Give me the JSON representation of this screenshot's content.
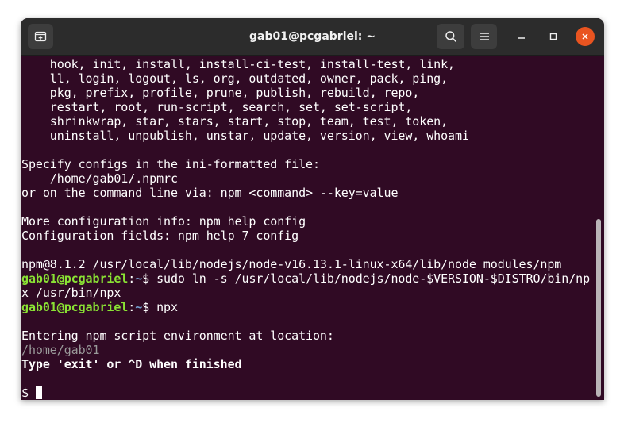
{
  "window": {
    "title": "gab01@pcgabriel: ~"
  },
  "titlebar_icons": {
    "new_tab": "new-tab-icon",
    "search": "search-icon",
    "menu": "hamburger-menu-icon",
    "minimize": "minimize-icon",
    "maximize": "maximize-icon",
    "close": "close-icon"
  },
  "colors": {
    "terminal_bg": "#300a24",
    "titlebar_bg": "#2c2c2c",
    "prompt_user": "#8ae234",
    "prompt_path": "#729fcf",
    "close_button": "#e95420"
  },
  "terminal": {
    "lines": [
      "    hook, init, install, install-ci-test, install-test, link,",
      "    ll, login, logout, ls, org, outdated, owner, pack, ping,",
      "    pkg, prefix, profile, prune, publish, rebuild, repo,",
      "    restart, root, run-script, search, set, set-script,",
      "    shrinkwrap, star, stars, start, stop, team, test, token,",
      "    uninstall, unpublish, unstar, update, version, view, whoami",
      "",
      "Specify configs in the ini-formatted file:",
      "    /home/gab01/.npmrc",
      "or on the command line via: npm <command> --key=value",
      "",
      "More configuration info: npm help config",
      "Configuration fields: npm help 7 config",
      "",
      "npm@8.1.2 /usr/local/lib/nodejs/node-v16.13.1-linux-x64/lib/node_modules/npm"
    ],
    "cmd1": {
      "user": "gab01@pcgabriel",
      "sep": ":",
      "path": "~",
      "dollar": "$ ",
      "command": "sudo ln -s /usr/local/lib/nodejs/node-$VERSION-$DISTRO/bin/np",
      "wrap": "x /usr/bin/npx"
    },
    "cmd2": {
      "user": "gab01@pcgabriel",
      "sep": ":",
      "path": "~",
      "dollar": "$ ",
      "command": "npx"
    },
    "blank_after_cmd2": "",
    "env_line": "Entering npm script environment at location:",
    "env_path": "/home/gab01",
    "exit_hint": "Type 'exit' or ^D when finished",
    "blank_before_prompt": "",
    "final_prompt": "$ "
  }
}
